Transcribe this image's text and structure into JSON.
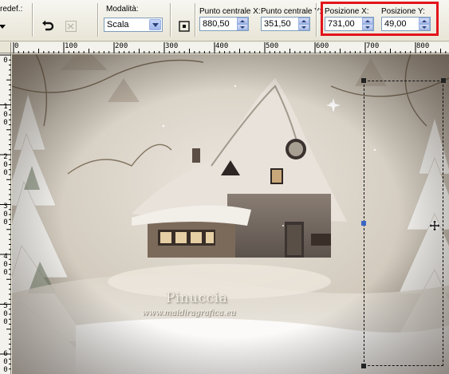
{
  "toolbar": {
    "preset_label": "redef.:",
    "mode_label": "Modalità:",
    "mode_value": "Scala",
    "center_x_label": "Punto centrale X:",
    "center_x_value": "880,50",
    "center_y_label": "Punto centrale Y:",
    "center_y_value": "351,50",
    "pos_x_label": "Posizione X:",
    "pos_x_value": "731,00",
    "pos_y_label": "Posizione Y:",
    "pos_y_value": "49,00",
    "icons": [
      "undo-icon",
      "reset-icon",
      "center-icon"
    ]
  },
  "ruler": {
    "top_ticks": [
      "0",
      "100",
      "200",
      "300",
      "400",
      "500",
      "600",
      "700",
      "800"
    ],
    "left_ticks": [
      "0",
      "100",
      "200",
      "300",
      "400",
      "500",
      "600"
    ]
  },
  "canvas": {
    "watermark_name": "Pinuccia",
    "watermark_url": "www.maidiragrafica.eu",
    "colors": {
      "sky": "#d9d3cb",
      "snow": "#f4f2ee",
      "wood": "#7a6454",
      "highlight": "#e3141b"
    }
  }
}
